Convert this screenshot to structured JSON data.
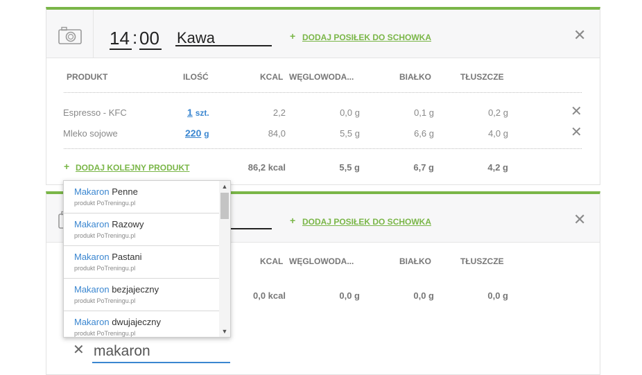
{
  "meal1": {
    "hour": "14",
    "sep": ":",
    "minute": "00",
    "name": "Kawa",
    "add_clip_label": "DODAJ POSIŁEK DO SCHOWKA",
    "plus": "+",
    "close": "✕",
    "headers": {
      "product": "PRODUKT",
      "qty": "ILOŚĆ",
      "kcal": "KCAL",
      "carbs": "WĘGLOWODA...",
      "protein": "BIAŁKO",
      "fat": "TŁUSZCZE"
    },
    "rows": [
      {
        "name": "Espresso - KFC",
        "qty": "1",
        "unit": "szt.",
        "kcal": "2,2",
        "carbs": "0,0 g",
        "protein": "0,1 g",
        "fat": "0,2 g"
      },
      {
        "name": "Mleko sojowe",
        "qty": "220",
        "unit": "g",
        "kcal": "84,0",
        "carbs": "5,5 g",
        "protein": "6,6 g",
        "fat": "4,0 g"
      }
    ],
    "add_product_label": "DODAJ KOLEJNY PRODUKT",
    "totals": {
      "kcal": "86,2 kcal",
      "carbs": "5,5 g",
      "protein": "6,7 g",
      "fat": "4,2 g"
    }
  },
  "meal2": {
    "add_clip_label": "DODAJ POSIŁEK DO SCHOWKA",
    "plus": "+",
    "close": "✕",
    "headers": {
      "kcal": "KCAL",
      "carbs": "WĘGLOWODA...",
      "protein": "BIAŁKO",
      "fat": "TŁUSZCZE"
    },
    "totals": {
      "kcal": "0,0 kcal",
      "carbs": "0,0 g",
      "protein": "0,0 g",
      "fat": "0,0 g"
    }
  },
  "autocomplete": {
    "items": [
      {
        "match": "Makaron",
        "rest": "Penne",
        "source": "produkt PoTreningu.pl"
      },
      {
        "match": "Makaron",
        "rest": "Razowy",
        "source": "produkt PoTreningu.pl"
      },
      {
        "match": "Makaron",
        "rest": "Pastani",
        "source": "produkt PoTreningu.pl"
      },
      {
        "match": "Makaron",
        "rest": "bezjajeczny",
        "source": "produkt PoTreningu.pl"
      },
      {
        "match": "Makaron",
        "rest": "dwujajeczny",
        "source": "produkt PoTreningu.pl"
      }
    ],
    "scroll_up": "▲",
    "scroll_down": "▼"
  },
  "search": {
    "clear": "✕",
    "value": "makaron"
  },
  "icons": {
    "camera": "camera-icon"
  },
  "colors": {
    "accent_green": "#7ab648",
    "link_blue": "#3a86d0"
  }
}
